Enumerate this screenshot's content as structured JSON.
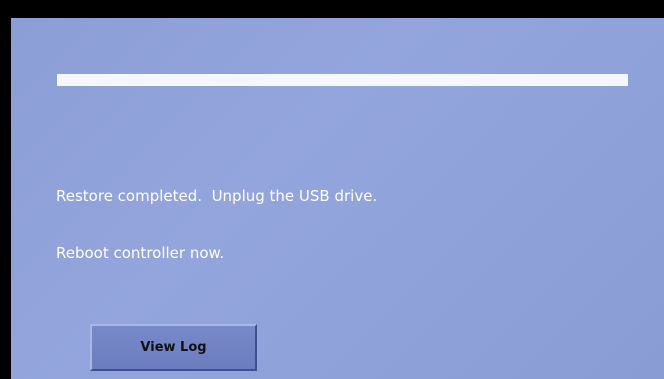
{
  "status": {
    "progress_fraction": 1.0,
    "message_line_1": "Restore completed.  Unplug the USB drive.",
    "message_line_2": "Reboot controller now."
  },
  "actions": {
    "view_log_label": "View Log"
  },
  "colors": {
    "screen_background": "#8c9ed6",
    "progress_fill": "#f6f7fb",
    "text": "#ffffff",
    "button_face": "#6f81c2"
  }
}
